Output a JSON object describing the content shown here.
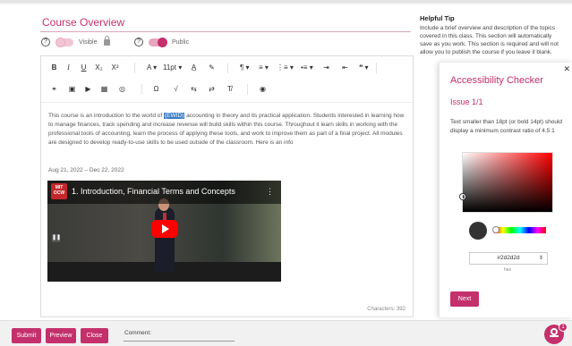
{
  "page": {
    "title": "Course Overview"
  },
  "visibility": {
    "visible_label": "Visible",
    "public_label": "Public",
    "help_glyph": "?"
  },
  "toolbar": {
    "row1": [
      {
        "name": "bold-button",
        "label": "B",
        "cls": "b"
      },
      {
        "name": "italic-button",
        "label": "I",
        "cls": "i"
      },
      {
        "name": "underline-button",
        "label": "U",
        "cls": "u"
      },
      {
        "name": "subscript-button",
        "label": "X₂",
        "cls": ""
      },
      {
        "name": "superscript-button",
        "label": "X²",
        "cls": ""
      },
      {
        "name": "font-color-button",
        "label": "A ▾",
        "cls": ""
      },
      {
        "name": "font-size-select",
        "label": "11pt ▾",
        "cls": ""
      },
      {
        "name": "text-color-icon",
        "label": "A̲",
        "cls": ""
      },
      {
        "name": "highlight-icon",
        "label": "✎",
        "cls": ""
      },
      {
        "name": "paragraph-button",
        "label": "¶ ▾",
        "cls": ""
      },
      {
        "name": "align-button",
        "label": "≡ ▾",
        "cls": ""
      },
      {
        "name": "ordered-list-button",
        "label": "⋮≡ ▾",
        "cls": ""
      },
      {
        "name": "bullet-list-button",
        "label": "•≡ ▾",
        "cls": ""
      },
      {
        "name": "indent-icon",
        "label": "⇥",
        "cls": ""
      },
      {
        "name": "outdent-icon",
        "label": "⇤",
        "cls": ""
      },
      {
        "name": "blockquote-button",
        "label": "❝ ▾",
        "cls": ""
      }
    ],
    "row2": [
      {
        "name": "link-icon",
        "label": "⚭"
      },
      {
        "name": "image-icon",
        "label": "▣"
      },
      {
        "name": "media-icon",
        "label": "▶"
      },
      {
        "name": "table-icon",
        "label": "▦"
      },
      {
        "name": "embed-icon",
        "label": "◎"
      },
      {
        "name": "omega-icon",
        "label": "Ω"
      },
      {
        "name": "equation-icon",
        "label": "√"
      },
      {
        "name": "rtl-icon",
        "label": "⇆"
      },
      {
        "name": "ltr-icon",
        "label": "⇄"
      },
      {
        "name": "clear-format-icon",
        "label": "T̸"
      },
      {
        "name": "accessibility-check-icon",
        "label": "◉"
      }
    ]
  },
  "editor": {
    "text_before": "This course is an introduction to the world of",
    "highlighted": "(EWID)",
    "text_after": "accounting in theory and its practical application. Students interested in learning how to manage finances, track spending and increase revenue will build skills within this course. Throughout it learn skills in working with the professional tools of accounting, learn the process of applying these tools, and work to improve them as part of a final project. All modules are designed to develop ready-to-use skills to be used outside of the classroom. Here is an info",
    "date_range": "Aug 21, 2022 – Dec 22, 2022",
    "char_count": "Characters: 392"
  },
  "video": {
    "logo_text": "MIT OCW",
    "title": "1. Introduction, Financial Terms and Concepts",
    "more_glyph": "⋮",
    "pause_glyph": "❚❚"
  },
  "helpful_tip": {
    "heading": "Helpful Tip",
    "text": "Include a brief overview and description of the topics covered in this class. This section will automatically save as you work. This section is required and will not allow you to publish the course if you leave it blank."
  },
  "accessibility_checker": {
    "title": "Accessibility Checker",
    "issue": "Issue 1/1",
    "description": "Text smaller than 18pt (or bold 14pt) should display a minimum contrast ratio of 4.5:1",
    "hex_value": "#2d2d2d",
    "hex_label": "hex",
    "next_label": "Next",
    "close_glyph": "✕",
    "hex_arrows": "⇕"
  },
  "footer": {
    "submit_label": "Submit",
    "preview_label": "Preview",
    "close_label": "Close",
    "comment_label": "Comment:",
    "badge_count": "1"
  },
  "colors": {
    "accent": "#c4306b",
    "accent_light": "#f3c4d4"
  }
}
